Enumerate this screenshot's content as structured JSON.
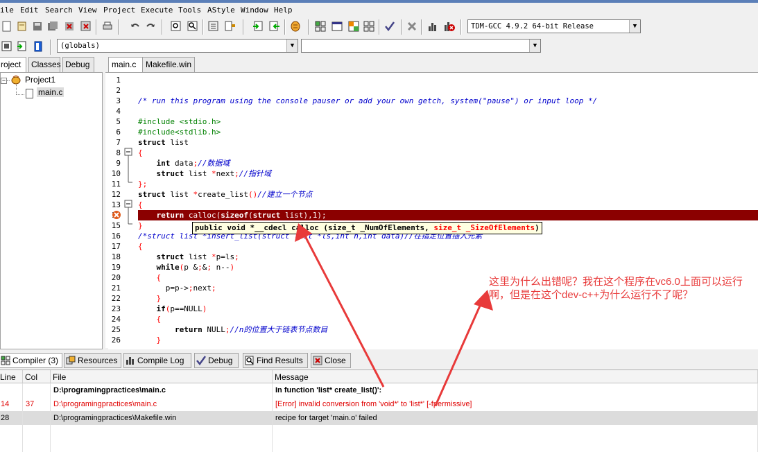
{
  "menu": [
    "ile",
    "Edit",
    "Search",
    "View",
    "Project",
    "Execute",
    "Tools",
    "AStyle",
    "Window",
    "Help"
  ],
  "toolbar": {
    "compiler_select": "TDM-GCC 4.9.2 64-bit Release",
    "scope_select": "(globals)",
    "function_select": ""
  },
  "left_panel": {
    "tabs": [
      "roject",
      "Classes",
      "Debug"
    ],
    "tree": {
      "project": "Project1",
      "file": "main.c"
    }
  },
  "editor": {
    "tabs": [
      "main.c",
      "Makefile.win"
    ],
    "lines": [
      {
        "n": "1",
        "t": ""
      },
      {
        "n": "2",
        "t": ""
      },
      {
        "n": "3",
        "t": "/* run this program using the console pauser or add your own getch, system(\"pause\") or input loop */"
      },
      {
        "n": "4",
        "t": ""
      },
      {
        "n": "5",
        "t": "#include <stdio.h>"
      },
      {
        "n": "6",
        "t": "#include<stdlib.h>"
      },
      {
        "n": "7",
        "t": "struct list"
      },
      {
        "n": "8",
        "t": "{"
      },
      {
        "n": "9",
        "t": "    int data;//数据域"
      },
      {
        "n": "10",
        "t": "    struct list *next;//指针域"
      },
      {
        "n": "11",
        "t": "};"
      },
      {
        "n": "12",
        "t": "struct list *create_list()//建立一个节点"
      },
      {
        "n": "13",
        "t": "{"
      },
      {
        "n": "14",
        "t": "    return calloc(sizeof(struct list),1);"
      },
      {
        "n": "15",
        "t": "}"
      },
      {
        "n": "16",
        "t": "/*struct list *insert_list(struct list *ls,int n,int data)//在指定位置插入元素"
      },
      {
        "n": "17",
        "t": "{"
      },
      {
        "n": "18",
        "t": "    struct list *p=ls;"
      },
      {
        "n": "19",
        "t": "    while(p && n--)"
      },
      {
        "n": "20",
        "t": "    {"
      },
      {
        "n": "21",
        "t": "      p=p->next;"
      },
      {
        "n": "22",
        "t": "    }"
      },
      {
        "n": "23",
        "t": "    if(p==NULL)"
      },
      {
        "n": "24",
        "t": "    {"
      },
      {
        "n": "25",
        "t": "        return NULL;//n的位置大于链表节点数目"
      },
      {
        "n": "26",
        "t": "    }"
      }
    ],
    "tooltip": {
      "prefix": "public void *__cdecl calloc (size_t _NumOfElements, ",
      "highlight": "size_t _SizeOfElements",
      "suffix": ")"
    }
  },
  "bottom": {
    "tabs": [
      "Compiler (3)",
      "Resources",
      "Compile Log",
      "Debug",
      "Find Results",
      "Close"
    ],
    "columns": [
      "Line",
      "Col",
      "File",
      "Message"
    ],
    "rows": [
      {
        "line": "",
        "col": "",
        "file": "D:\\programingpractices\\main.c",
        "message": "In function 'list* create_list()':"
      },
      {
        "line": "14",
        "col": "37",
        "file": "D:\\programingpractices\\main.c",
        "message": "[Error] invalid conversion from 'void*' to 'list*' [-fpermissive]"
      },
      {
        "line": "28",
        "col": "",
        "file": "D:\\programingpractices\\Makefile.win",
        "message": "recipe for target 'main.o' failed"
      }
    ]
  },
  "annotation": "这里为什么出错呢？我在这个程序在vc6.0上面可以运行啊，但是在这个dev-c++为什么运行不了呢？",
  "colors": {
    "error_line": "#8b0000",
    "annotation": "#e83a3a",
    "error_text": "#e00000",
    "comment": "#0000cc",
    "preprocessor": "#008000"
  }
}
